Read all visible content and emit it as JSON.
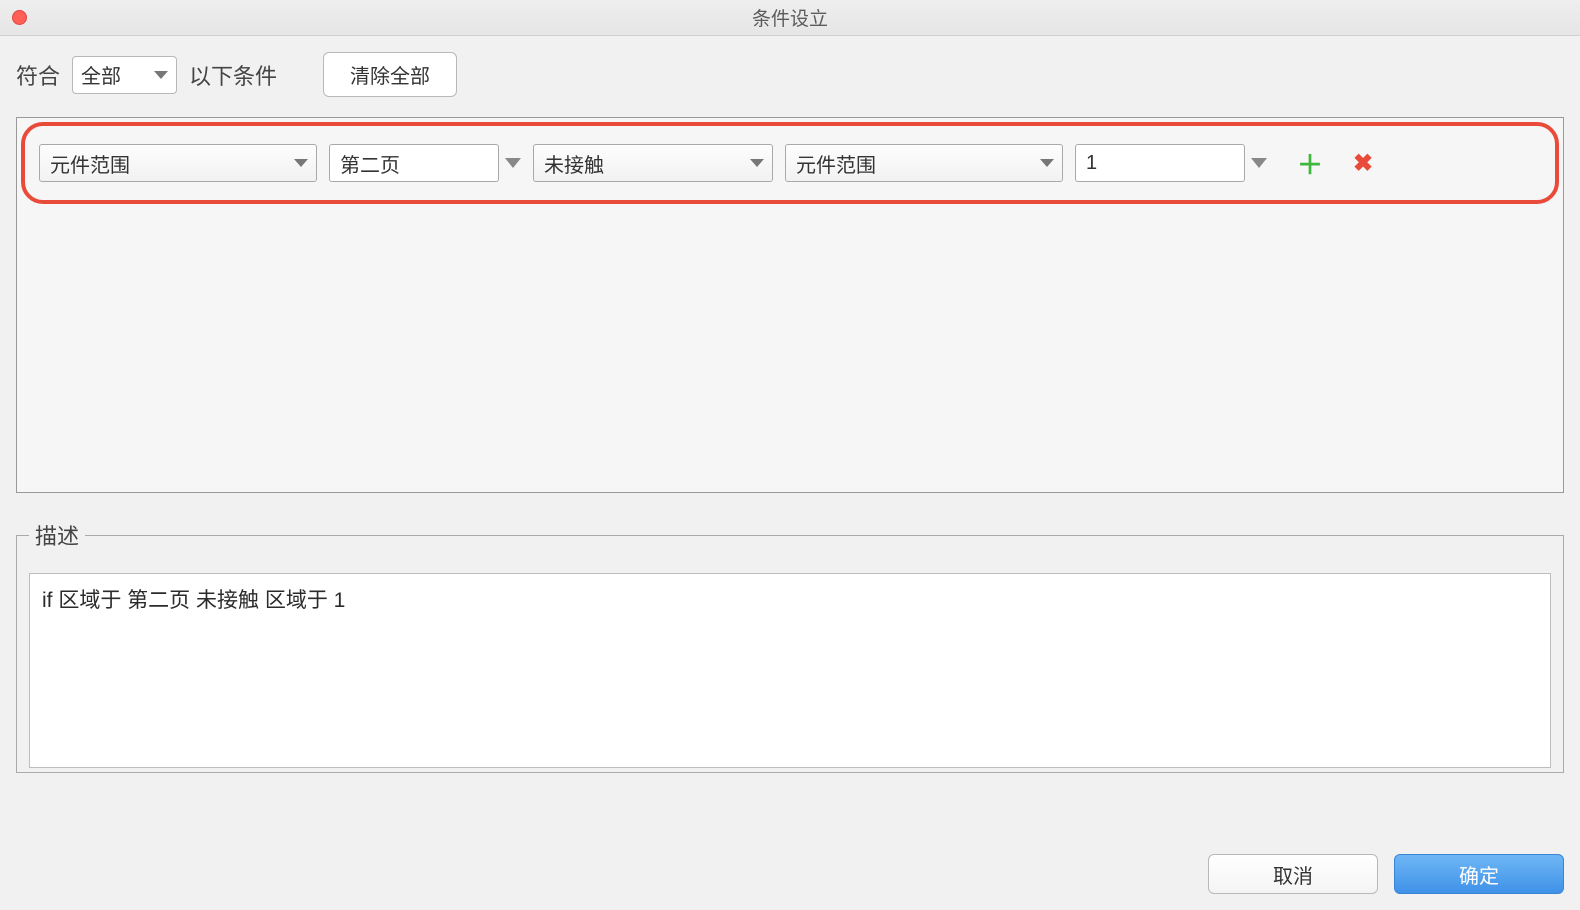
{
  "window": {
    "title": "条件设立"
  },
  "topBar": {
    "matchLabel": "符合",
    "matchMode": "全部",
    "suffixLabel": "以下条件",
    "clearAll": "清除全部"
  },
  "condition": {
    "field1": "元件范围",
    "field2": "第二页",
    "field3": "未接触",
    "field4": "元件范围",
    "field5": "1"
  },
  "description": {
    "label": "描述",
    "text": "if 区域于 第二页 未接触 区域于 1"
  },
  "footer": {
    "cancel": "取消",
    "ok": "确定"
  }
}
